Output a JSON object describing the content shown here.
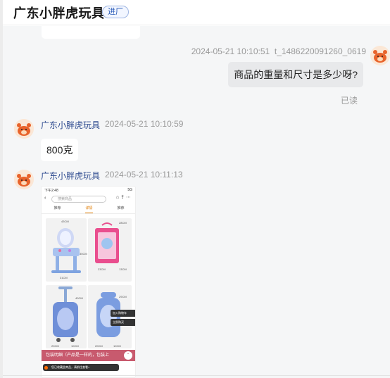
{
  "header": {
    "shop_name": "广东小胖虎玩具",
    "tag": "进厂"
  },
  "messages": {
    "outgoing": {
      "timestamp": "2024-05-21 10:10:51",
      "user_id": "t_1486220091260_0619",
      "text": "商品的重量和尺寸是多少呀?",
      "read_status": "已读"
    },
    "reply1": {
      "sender": "广东小胖虎玩具",
      "timestamp": "2024-05-21 10:10:59",
      "text": "800克"
    },
    "reply2": {
      "sender": "广东小胖虎玩具",
      "timestamp": "2024-05-21 10:11:13"
    }
  },
  "image_preview": {
    "status_time": "下午2:48",
    "status_right": "5G",
    "search_placeholder": "搜索商品",
    "tabs": [
      "推荐",
      "详情",
      "推荐"
    ],
    "active_tab": 1,
    "dimensions": {
      "p1_top": "43CM",
      "p1_side": "35CM",
      "p1_bottom": "31CM",
      "p2_side": "28CM",
      "p2_bottom": "23CM",
      "p2_depth": "13CM",
      "p3_side": "40CM",
      "p3_bottom": "20CM",
      "p3_depth": "10CM",
      "p4_side": "29CM",
      "p4_bottom": "20CM",
      "p4_depth": "10CM"
    },
    "popup1": "加入购物车",
    "popup2": "立即购买",
    "pack_text": "包装明细（产品是一样的，包装上",
    "toast_text": "您已收藏此商品，请前往查看>"
  },
  "colors": {
    "accent_blue": "#2d4a8f",
    "bubble_out": "#e8e9eb",
    "bubble_in": "#ffffff",
    "chat_bg": "#f5f6f7",
    "pack_bar": "#c85a6e"
  }
}
